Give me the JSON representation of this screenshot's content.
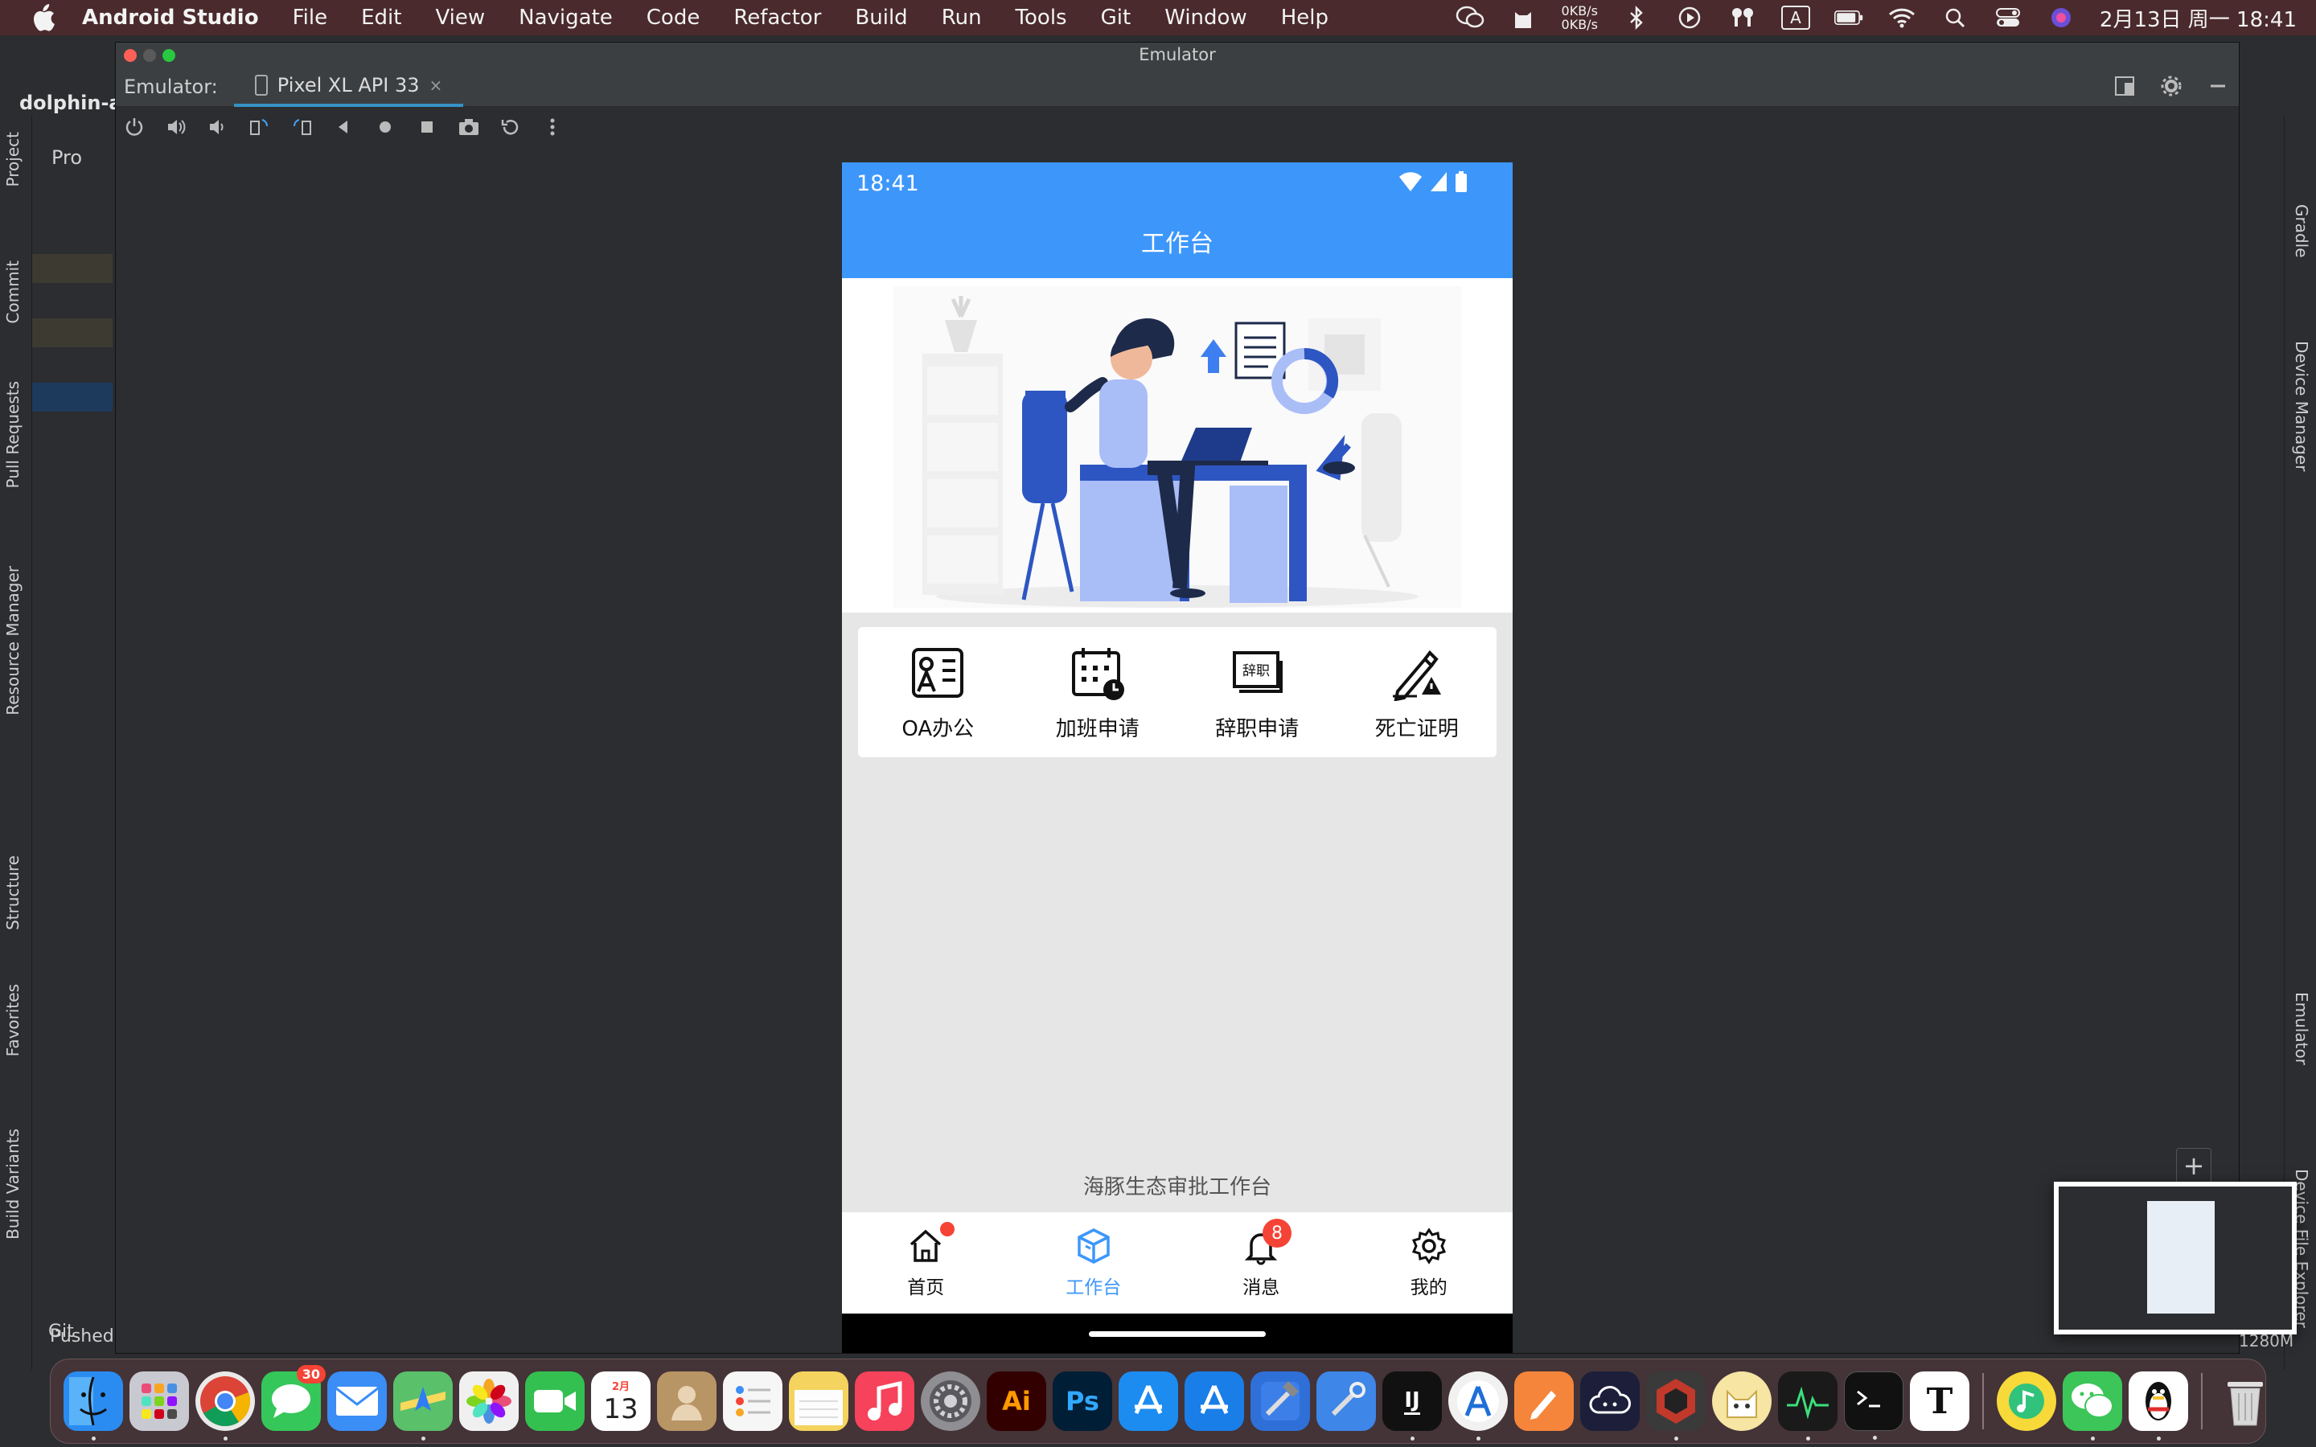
{
  "menubar": {
    "app_name": "Android Studio",
    "items": [
      "File",
      "Edit",
      "View",
      "Navigate",
      "Code",
      "Refactor",
      "Build",
      "Run",
      "Tools",
      "Git",
      "Window",
      "Help"
    ],
    "net_up": "0KB/s",
    "net_down": "0KB/s",
    "input_method": "A",
    "datetime": "2月13日 周一  18:41"
  },
  "ide": {
    "project_title": "dolphin-a",
    "left_tabs": [
      "Project",
      "Commit",
      "Pull Requests",
      "Resource Manager",
      "Structure",
      "Favorites",
      "Build Variants"
    ],
    "right_tabs": [
      "Gradle",
      "Device Manager",
      "Emulator",
      "Device File Explorer"
    ],
    "git_label": "Git",
    "pushed_label": "Pushed",
    "memory": "1280M",
    "project_tab_label": "Pro"
  },
  "emulator": {
    "window_title": "Emulator",
    "label": "Emulator:",
    "device_tab": "Pixel XL API 33",
    "close_symbol": "×"
  },
  "phone": {
    "status_time": "18:41",
    "title": "工作台",
    "grid_items": [
      {
        "label": "OA办公",
        "icon": "id-card-icon"
      },
      {
        "label": "加班申请",
        "icon": "calendar-clock-icon"
      },
      {
        "label": "辞职申请",
        "icon": "resignation-letter-icon"
      },
      {
        "label": "死亡证明",
        "icon": "pen-warning-icon"
      }
    ],
    "resign_icon_text": "辞职",
    "footer": "海豚生态审批工作台",
    "nav": [
      {
        "label": "首页",
        "icon": "home-icon",
        "active": false,
        "dot": true
      },
      {
        "label": "工作台",
        "icon": "cube-icon",
        "active": true
      },
      {
        "label": "消息",
        "icon": "bell-icon",
        "active": false,
        "badge": "8"
      },
      {
        "label": "我的",
        "icon": "gear-icon",
        "active": false
      }
    ]
  },
  "dock": {
    "apps": [
      {
        "name": "Finder",
        "color": "#2a8cf0"
      },
      {
        "name": "Launchpad",
        "color": "#c9c9d2"
      },
      {
        "name": "Chrome",
        "color": "#e9e9e9"
      },
      {
        "name": "Messages",
        "color": "#35c759",
        "badge": "30"
      },
      {
        "name": "Mail",
        "color": "#3a8ef6"
      },
      {
        "name": "Maps",
        "color": "#5ac06a"
      },
      {
        "name": "Photos",
        "color": "#f0f0f0"
      },
      {
        "name": "FaceTime",
        "color": "#33c050"
      },
      {
        "name": "Calendar",
        "color": "#ffffff"
      },
      {
        "name": "Contacts",
        "color": "#b89565"
      },
      {
        "name": "Reminders",
        "color": "#f6f6f6"
      },
      {
        "name": "Notes",
        "color": "#f4d35e"
      },
      {
        "name": "Music",
        "color": "#f6425a"
      },
      {
        "name": "System Preferences",
        "color": "#8e8e93"
      },
      {
        "name": "Illustrator",
        "color": "#330000"
      },
      {
        "name": "Photoshop",
        "color": "#001e36"
      },
      {
        "name": "App Store",
        "color": "#1c8cf0"
      },
      {
        "name": "Xcode Store",
        "color": "#1a7ee8"
      },
      {
        "name": "Xcode",
        "color": "#2f6fd8"
      },
      {
        "name": "Instruments",
        "color": "#3e86e8"
      },
      {
        "name": "IntelliJ",
        "color": "#111111"
      },
      {
        "name": "Android Studio",
        "color": "#f1f1f1"
      },
      {
        "name": "Pages",
        "color": "#f5853a"
      },
      {
        "name": "Cloud",
        "color": "#1c1e3a"
      },
      {
        "name": "Zoom",
        "color": "#3a3a3a"
      },
      {
        "name": "Cat",
        "color": "#f6e5a3"
      },
      {
        "name": "Activity Monitor",
        "color": "#1a1a1a"
      },
      {
        "name": "Terminal",
        "color": "#111111"
      },
      {
        "name": "Typora",
        "color": "#ffffff"
      },
      {
        "name": "QQ Music",
        "color": "#f7d93a"
      },
      {
        "name": "WeChat",
        "color": "#3cc558"
      },
      {
        "name": "QQ",
        "color": "#ffffff"
      },
      {
        "name": "Trash",
        "color": "#d8d8d8"
      }
    ],
    "calendar_month": "2月",
    "calendar_day": "13",
    "ai_text": "Ai",
    "ps_text": "Ps",
    "ij_text": "IJ",
    "typora_text": "T"
  }
}
